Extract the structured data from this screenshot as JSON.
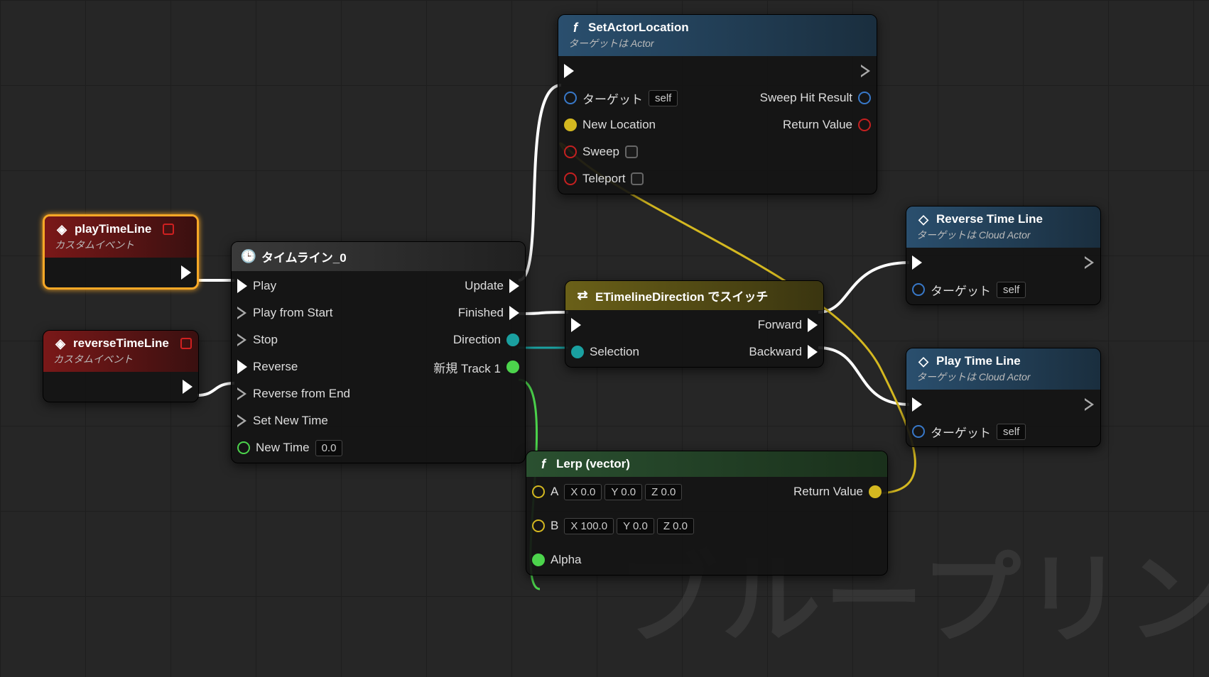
{
  "watermark": "ブループリン",
  "nodes": {
    "playTimeLine": {
      "title": "playTimeLine",
      "subtitle": "カスタムイベント"
    },
    "reverseTimeLine": {
      "title": "reverseTimeLine",
      "subtitle": "カスタムイベント"
    },
    "timeline": {
      "title": "タイムライン_0",
      "inputs": {
        "play": "Play",
        "playFromStart": "Play from Start",
        "stop": "Stop",
        "reverse": "Reverse",
        "reverseFromEnd": "Reverse from End",
        "setNewTime": "Set New Time",
        "newTime": "New Time",
        "newTimeValue": "0.0"
      },
      "outputs": {
        "update": "Update",
        "finished": "Finished",
        "direction": "Direction",
        "track1": "新規 Track 1"
      }
    },
    "setActorLocation": {
      "title": "SetActorLocation",
      "subtitle": "ターゲットは Actor",
      "inputs": {
        "target": "ターゲット",
        "targetValue": "self",
        "newLocation": "New Location",
        "sweep": "Sweep",
        "teleport": "Teleport"
      },
      "outputs": {
        "sweepHit": "Sweep Hit Result",
        "returnValue": "Return Value"
      }
    },
    "switch": {
      "title": "ETimelineDirection でスイッチ",
      "selection": "Selection",
      "forward": "Forward",
      "backward": "Backward"
    },
    "lerp": {
      "title": "Lerp (vector)",
      "a": "A",
      "b": "B",
      "alpha": "Alpha",
      "returnValue": "Return Value",
      "ax": "X  0.0",
      "ay": "Y  0.0",
      "az": "Z  0.0",
      "bx": "X  100.0",
      "by": "Y  0.0",
      "bz": "Z  0.0"
    },
    "reverseCall": {
      "title": "Reverse Time Line",
      "subtitle": "ターゲットは Cloud Actor",
      "target": "ターゲット",
      "targetValue": "self"
    },
    "playCall": {
      "title": "Play Time Line",
      "subtitle": "ターゲットは Cloud Actor",
      "target": "ターゲット",
      "targetValue": "self"
    }
  }
}
